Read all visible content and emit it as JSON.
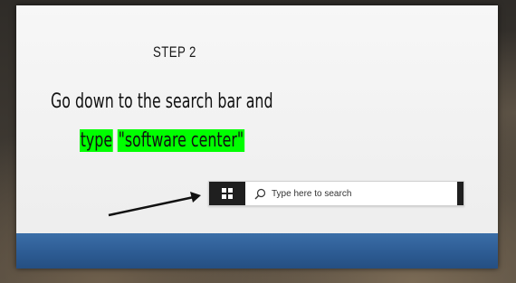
{
  "slide": {
    "step_title": "STEP 2",
    "instruction_line1": "Go down to the search bar and",
    "instruction_line2_prefix": "type",
    "instruction_line2_highlight": "\"software center\""
  },
  "taskbar": {
    "start_icon": "windows-logo-icon",
    "search_icon": "search-icon",
    "search_placeholder": "Type here to search",
    "search_value": ""
  },
  "colors": {
    "highlight": "#00ff00",
    "footer_band": "#2f5f98",
    "taskbar_dark": "#1f1f1f"
  }
}
